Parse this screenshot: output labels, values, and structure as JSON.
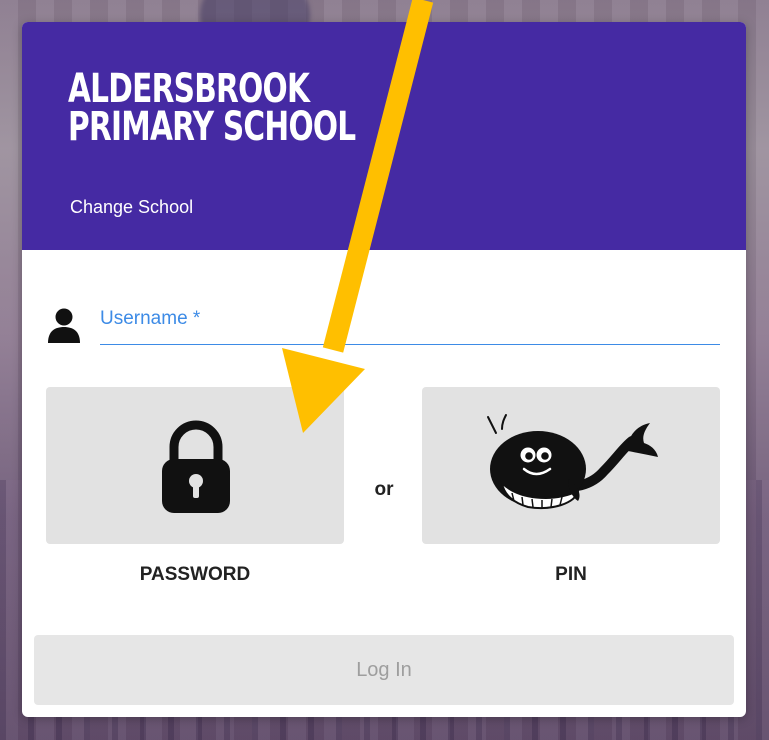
{
  "school": {
    "name_line1": "ALDERSBROOK",
    "name_line2": "PRIMARY SCHOOL",
    "change_school_label": "Change School"
  },
  "form": {
    "username_label": "Username *",
    "username_value": "",
    "separator": "or",
    "password_option_label": "PASSWORD",
    "pin_option_label": "PIN",
    "login_button_label": "Log In"
  },
  "icons": {
    "user": "user-icon",
    "password": "padlock-icon",
    "pin": "whale-icon",
    "annotation": "arrow-annotation"
  },
  "colors": {
    "header_purple": "#452aa3",
    "input_underline": "#3d8be6",
    "tile_gray": "#e2e2e2",
    "arrow_yellow": "#ffbf00",
    "disabled_text": "#9e9e9e"
  }
}
